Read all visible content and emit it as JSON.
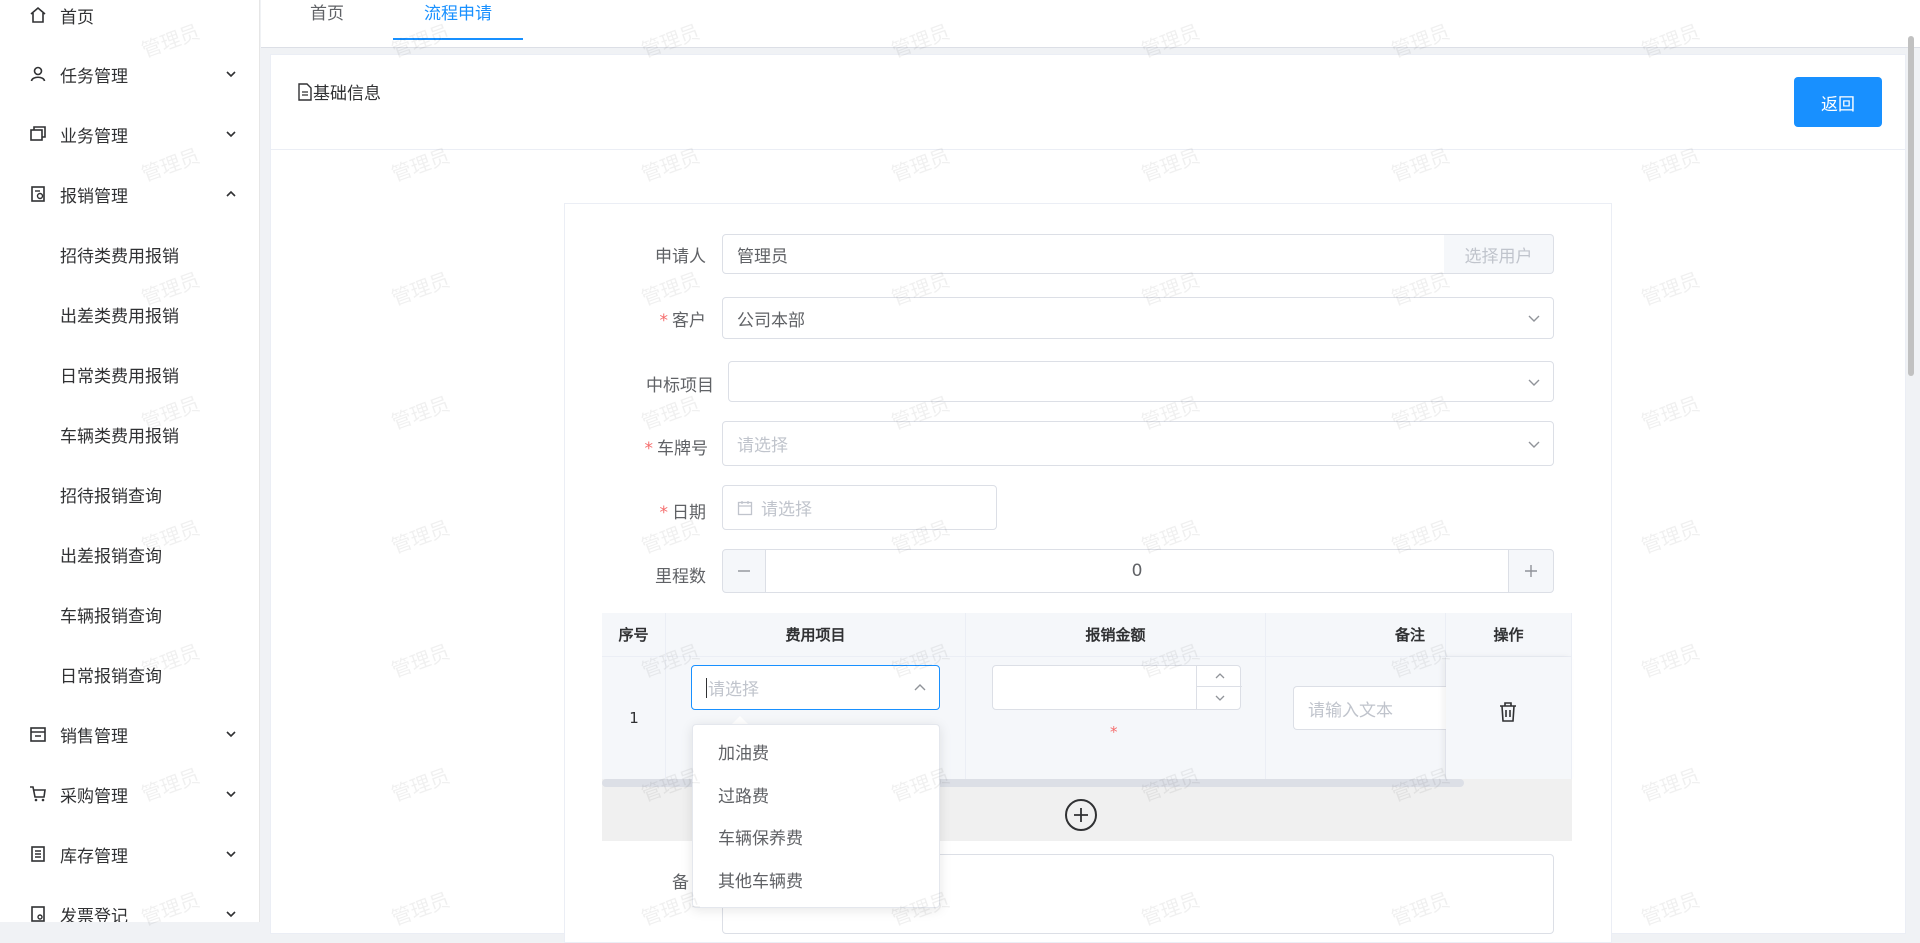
{
  "sidebar": {
    "items": [
      {
        "label": "首页",
        "icon": "home-icon"
      },
      {
        "label": "任务管理",
        "icon": "user-icon"
      },
      {
        "label": "业务管理",
        "icon": "copy-icon"
      },
      {
        "label": "报销管理",
        "icon": "receipt-icon"
      },
      {
        "label": "销售管理",
        "icon": "store-icon"
      },
      {
        "label": "采购管理",
        "icon": "cart-icon"
      },
      {
        "label": "库存管理",
        "icon": "inventory-icon"
      },
      {
        "label": "发票登记",
        "icon": "invoice-icon"
      }
    ],
    "sub_items": [
      "招待类费用报销",
      "出差类费用报销",
      "日常类费用报销",
      "车辆类费用报销",
      "招待报销查询",
      "出差报销查询",
      "车辆报销查询",
      "日常报销查询"
    ]
  },
  "tabs": [
    {
      "label": "首页",
      "active": false
    },
    {
      "label": "流程申请",
      "active": true
    }
  ],
  "card": {
    "title": "基础信息",
    "back_label": "返回"
  },
  "form": {
    "applicant_label": "申请人",
    "applicant_value": "管理员",
    "select_user_label": "选择用户",
    "customer_label": "客户",
    "customer_value": "公司本部",
    "project_label": "中标项目",
    "plate_label": "车牌号",
    "plate_placeholder": "请选择",
    "date_label": "日期",
    "date_placeholder": "请选择",
    "mileage_label": "里程数",
    "mileage_value": "0",
    "remark_label": "备"
  },
  "table": {
    "headers": [
      "序号",
      "费用项目",
      "报销金额",
      "备注",
      "操作"
    ],
    "row_index": "1",
    "expense_placeholder": "请选择",
    "remark_placeholder": "请输入文本",
    "required_mark": "*"
  },
  "dropdown": {
    "options": [
      "加油费",
      "过路费",
      "车辆保养费",
      "其他车辆费"
    ]
  },
  "watermark_text": "管理员",
  "colors": {
    "primary": "#1890ff",
    "required": "#f56c6c"
  }
}
